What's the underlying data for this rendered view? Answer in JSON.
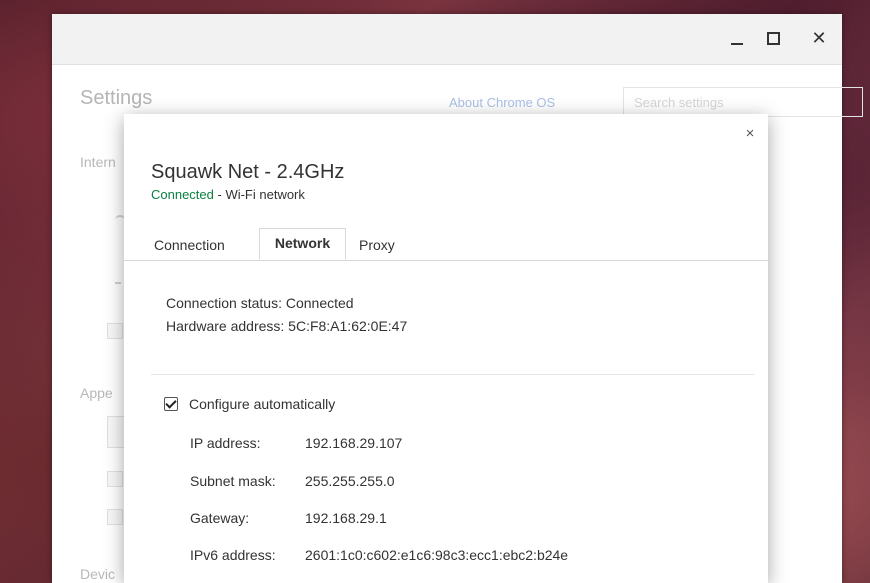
{
  "window": {
    "controls": {
      "minimize_icon": "minimize-icon",
      "maximize_icon": "maximize-icon",
      "close_glyph": "✕"
    }
  },
  "settings": {
    "title": "Settings",
    "about_link": "About Chrome OS",
    "search_placeholder": "Search settings",
    "sections": [
      "Intern",
      "Appe",
      "Devic"
    ]
  },
  "dialog": {
    "close_glyph": "×",
    "network_name": "Squawk Net - 2.4GHz",
    "status_connected": "Connected",
    "status_suffix": " - Wi-Fi network",
    "tabs": [
      {
        "label": "Connection",
        "active": false
      },
      {
        "label": "Network",
        "active": true
      },
      {
        "label": "Proxy",
        "active": false
      }
    ],
    "info": {
      "connection_status_label": "Connection status:",
      "connection_status_value": "Connected",
      "hardware_address_label": "Hardware address:",
      "hardware_address_value": "5C:F8:A1:62:0E:47"
    },
    "configure_automatically": {
      "label": "Configure automatically",
      "checked": true
    },
    "ip_fields": [
      {
        "label": "IP address:",
        "value": "192.168.29.107"
      },
      {
        "label": "Subnet mask:",
        "value": "255.255.255.0"
      },
      {
        "label": "Gateway:",
        "value": "192.168.29.1"
      },
      {
        "label": "IPv6 address:",
        "value": "2601:1c0:c602:e1c6:98c3:ecc1:ebc2:b24e"
      }
    ]
  },
  "colors": {
    "connected_green": "#0b8043",
    "accent_link": "#a9c0e6"
  }
}
